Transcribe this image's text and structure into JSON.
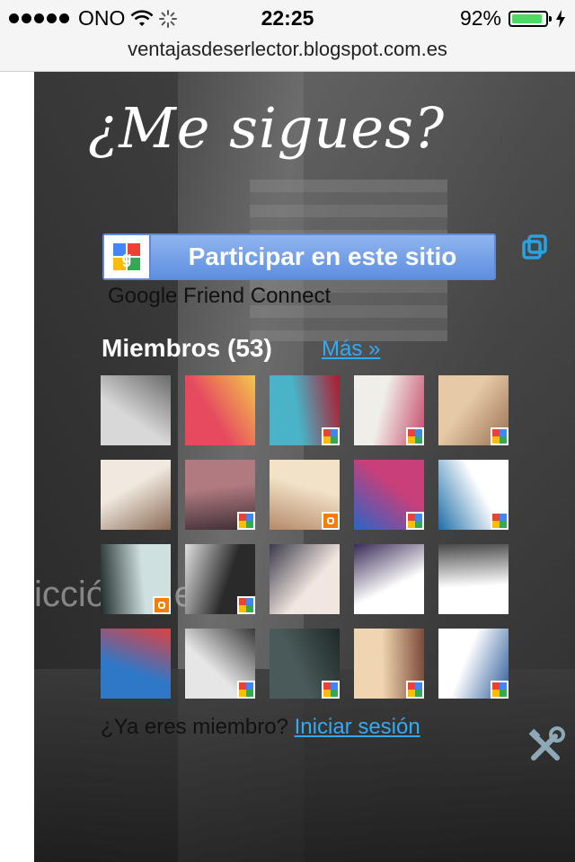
{
  "status_bar": {
    "carrier": "ONO",
    "time": "22:25",
    "battery_text": "92%",
    "battery_level": 0.92,
    "battery_color": "#4cd964",
    "icons": [
      "signal-dots-icon",
      "wifi-icon",
      "loading-spinner-icon",
      "battery-icon",
      "charging-bolt-icon"
    ]
  },
  "browser": {
    "url": "ventajasdeserlector.blogspot.com.es"
  },
  "widget": {
    "title": "¿Me sigues?",
    "join_button_label": "Participar en este sitio",
    "provider_caption": "Google Friend Connect",
    "members_heading": "Miembros (53)",
    "more_link": "Más »",
    "member_question": "¿Ya eres miembro?",
    "login_link": "Iniciar sesión",
    "background_text": "icció   s  d        e  ad.",
    "link_color": "#33aaf5",
    "button_color": "#6e9be6",
    "members": [
      {
        "badge": "none",
        "colors": [
          "#d8d8d8",
          "#6a6a6a"
        ]
      },
      {
        "badge": "none",
        "colors": [
          "#e64a5f",
          "#f2c84b"
        ]
      },
      {
        "badge": "google",
        "colors": [
          "#4ab3c7",
          "#b0182a"
        ]
      },
      {
        "badge": "google",
        "colors": [
          "#f0eee8",
          "#c74a6a"
        ]
      },
      {
        "badge": "google",
        "colors": [
          "#e6caa8",
          "#9a6f50"
        ]
      },
      {
        "badge": "none",
        "colors": [
          "#efe9df",
          "#8c6a55"
        ]
      },
      {
        "badge": "google",
        "colors": [
          "#b07a80",
          "#3e2e35"
        ]
      },
      {
        "badge": "blogger",
        "colors": [
          "#f2e2c8",
          "#b58a6a"
        ]
      },
      {
        "badge": "google",
        "colors": [
          "#c83f7a",
          "#2a64c8"
        ]
      },
      {
        "badge": "google",
        "colors": [
          "#ffffff",
          "#1e6ea8"
        ]
      },
      {
        "badge": "blogger",
        "colors": [
          "#cfe0e0",
          "#1f2a2a"
        ]
      },
      {
        "badge": "google",
        "colors": [
          "#2a2a2a",
          "#e0e0e0"
        ]
      },
      {
        "badge": "none",
        "colors": [
          "#f2e6e0",
          "#3a3a4a"
        ]
      },
      {
        "badge": "none",
        "colors": [
          "#ffffff",
          "#3a2a55"
        ]
      },
      {
        "badge": "none",
        "colors": [
          "#ffffff",
          "#4a4a4a"
        ]
      },
      {
        "badge": "none",
        "colors": [
          "#2f78c8",
          "#e04040"
        ]
      },
      {
        "badge": "google",
        "colors": [
          "#e6e6e6",
          "#3a3a3a"
        ]
      },
      {
        "badge": "google",
        "colors": [
          "#4a5a5a",
          "#1f2828"
        ]
      },
      {
        "badge": "google",
        "colors": [
          "#f0d6b0",
          "#7a4a3a"
        ]
      },
      {
        "badge": "google",
        "colors": [
          "#ffffff",
          "#2a5a9a"
        ]
      }
    ]
  }
}
